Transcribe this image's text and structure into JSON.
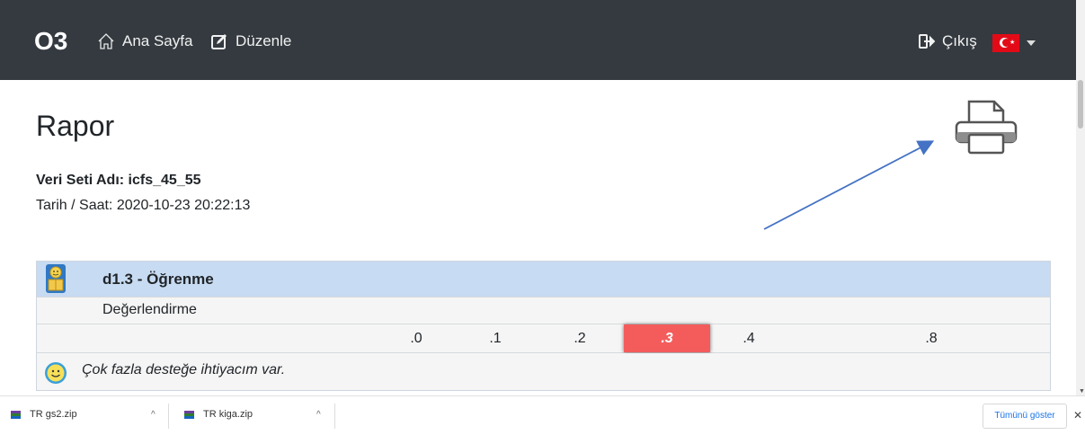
{
  "nav": {
    "brand": "O3",
    "home_label": "Ana Sayfa",
    "edit_label": "Düzenle",
    "logout_label": "Çıkış",
    "language": "TR"
  },
  "report": {
    "title": "Rapor",
    "dataset": "Veri Seti Adı: icfs_45_55",
    "datetime": "Tarih / Saat: 2020-10-23 20:22:13"
  },
  "table": {
    "heading": "d1.3 - Öğrenme",
    "eval_label": "Değerlendirme",
    "scale": [
      ".0",
      ".1",
      ".2",
      ".3",
      ".4",
      ".8"
    ],
    "selected": ".3",
    "answer": "Çok fazla desteğe ihtiyacım var."
  },
  "annotation": {
    "arrow_color": "#4472c4"
  },
  "downloads": {
    "items": [
      "TR gs2.zip",
      "TR kiga.zip"
    ],
    "show_all": "Tümünü göster"
  },
  "colors": {
    "navbar": "#343a40",
    "header_row": "#c7dbf2",
    "selected_cell": "#f45c5c",
    "link_blue": "#1a73e8"
  }
}
